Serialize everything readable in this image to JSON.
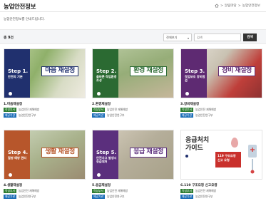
{
  "header": {
    "title": "농업안전정보",
    "breadcrumb": [
      "알림마당",
      "농업안전정보"
    ],
    "subtitle": "농업안전정보를 안내드립니다."
  },
  "search": {
    "total_prefix": "총",
    "total_count": "9",
    "total_suffix": "건",
    "select_value": "전체보기",
    "input_placeholder": "검색",
    "button_label": "검색"
  },
  "cards": [
    {
      "step": "Step 1.",
      "desc": "안전의 기본",
      "badge": "마음 재설정",
      "title": "1.마음재설정",
      "tags": [
        "작성부서",
        "제공기관"
      ],
      "meta": [
        "농업안전 재해예방",
        "농업안전연구부"
      ],
      "panel_color": "#20306e",
      "badge_color": "#20306e",
      "photo": "green"
    },
    {
      "step": "Step 2.",
      "desc": "올바른 작업환경 조성",
      "badge": "환경 재설정",
      "title": "2.환경재설정",
      "tags": [
        "작성부서",
        "제공기관"
      ],
      "meta": [
        "농업안전 재해예방",
        "농업안전연구부"
      ],
      "panel_color": "#2b6a32",
      "badge_color": "#2b6a32",
      "photo": "field"
    },
    {
      "step": "Step 3.",
      "desc": "작업보조 장비점검",
      "badge": "장비 재설정",
      "title": "3.장비재설정",
      "tags": [
        "작성부서",
        "제공기관"
      ],
      "meta": [
        "농업안전 재해예방",
        "농업안전연구부"
      ],
      "panel_color": "#5e2a72",
      "badge_color": "#5e2a72",
      "photo": "machine"
    },
    {
      "step": "Step 4.",
      "desc": "질병 예방 관리",
      "badge": "생활 재설정",
      "title": "4.생활재설정",
      "tags": [
        "작성부서",
        "제공기관"
      ],
      "meta": [
        "농업안전 재해예방",
        "농업안전연구부"
      ],
      "panel_color": "#b7562b",
      "badge_color": "#b7562b",
      "photo": "farm"
    },
    {
      "step": "Step 5.",
      "desc": "안전사고 발생시 응급대처",
      "badge": "응급 재설정",
      "title": "5.응급재설정",
      "tags": [
        "작성부서",
        "제공기관"
      ],
      "meta": [
        "농업안전 재해예방",
        "농업안전연구부"
      ],
      "panel_color": "#5b2f7d",
      "badge_color": "#5b2f7d",
      "photo": "help"
    },
    {
      "guide_title_1": "응급처치",
      "guide_title_2": "가이드",
      "guide_sub": "119 구조요청 신고 요령",
      "title": "6.119 구조요청 신고요령",
      "tags": [
        "작성부서",
        "제공기관"
      ],
      "meta": [
        "농업안전 재해예방",
        "농업안전연구부"
      ],
      "photo": "guide"
    }
  ]
}
